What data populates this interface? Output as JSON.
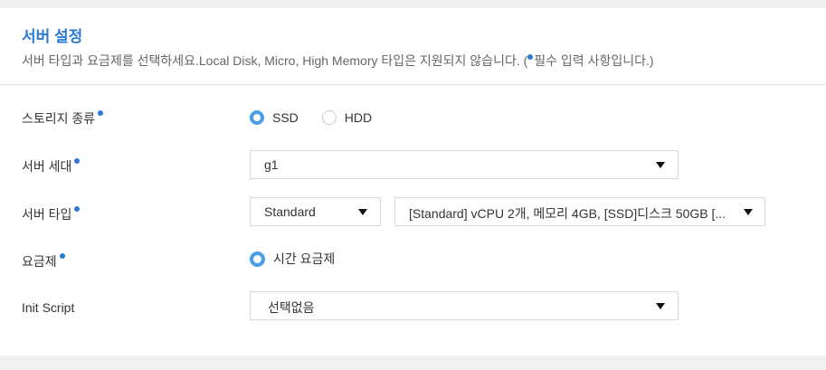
{
  "section": {
    "title": "서버 설정",
    "description_prefix": "서버 타입과 요금제를 선택하세요.Local Disk, Micro, High Memory 타입은 지원되지 않습니다. (",
    "description_suffix": "필수 입력 사항입니다.)"
  },
  "fields": {
    "storage": {
      "label": "스토리지 종류",
      "options": [
        "SSD",
        "HDD"
      ],
      "selected": "SSD"
    },
    "generation": {
      "label": "서버 세대",
      "value": "g1"
    },
    "server_type": {
      "label": "서버 타입",
      "type_value": "Standard",
      "spec_value": "[Standard] vCPU 2개, 메모리 4GB, [SSD]디스크 50GB [..."
    },
    "pricing": {
      "label": "요금제",
      "options": [
        "시간 요금제"
      ],
      "selected": "시간 요금제"
    },
    "init_script": {
      "label": "Init Script",
      "value": "선택없음"
    }
  },
  "colors": {
    "accent": "#2d7ad6",
    "radio_checked": "#4a9ee8",
    "background": "#f0f0f0",
    "panel": "#ffffff"
  },
  "icons": {
    "required": "dot-icon",
    "dropdown": "caret-down-icon"
  }
}
